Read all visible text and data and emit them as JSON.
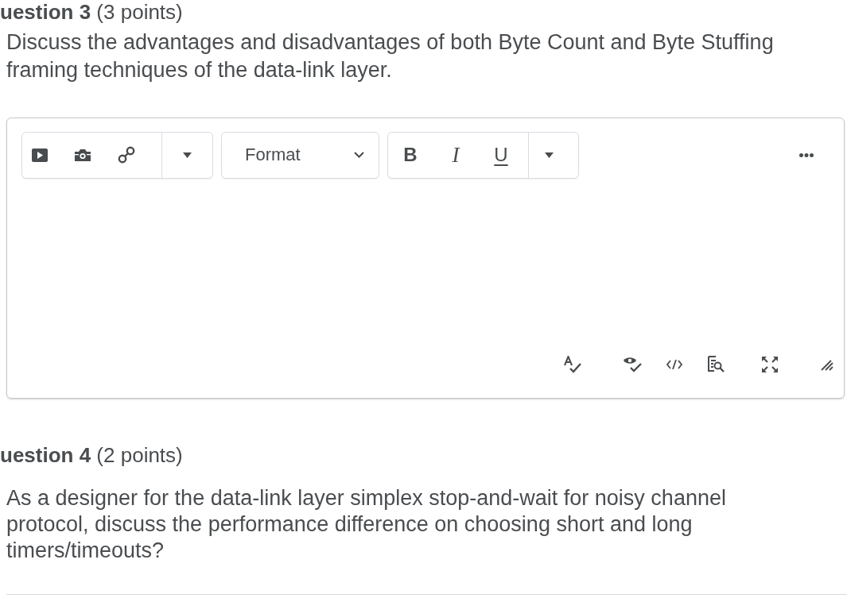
{
  "question_3": {
    "heading": "**uestion 3** (3 points)",
    "prompt": "Discuss the advantages and disadvantages of both Byte Count and Byte Stuffing framing techniques of the data-link layer."
  },
  "editor": {
    "format_select": {
      "value": "Format"
    },
    "style_buttons": [
      {
        "label": "B",
        "kind": "bold"
      },
      {
        "label": "I",
        "kind": "italic"
      },
      {
        "label": "U",
        "kind": "underline"
      }
    ]
  },
  "question_4": {
    "heading": "**uestion 4** (2 points)",
    "prompt": "As a designer for the data-link layer simplex stop-and-wait for noisy channel protocol, discuss the performance difference on choosing short and long timers/timeouts?"
  }
}
